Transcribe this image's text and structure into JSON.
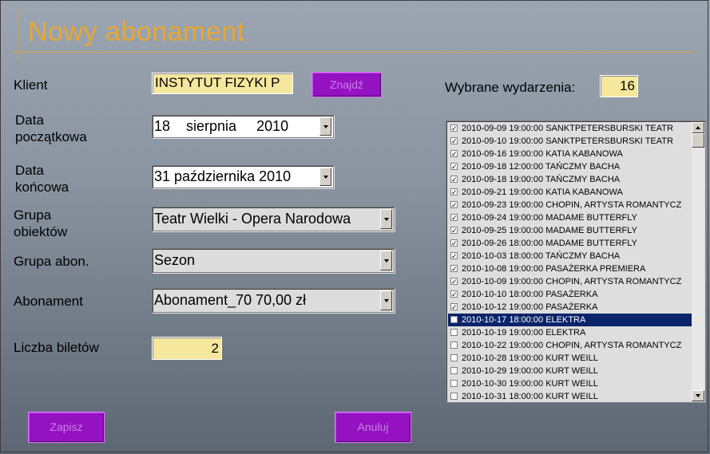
{
  "window": {
    "title": "Nowy abonament"
  },
  "form": {
    "client_label": "Klient",
    "client_value": "INSTYTUT FIZYKI P",
    "find_button": "Znajdź",
    "start_label_1": "Data",
    "start_label_2": "początkowa",
    "start_value": "18    sierpnia     2010",
    "end_label_1": "Data",
    "end_label_2": "końcowa",
    "end_value": "31 października 2010",
    "group_label_1": "Grupa",
    "group_label_2": "obiektów",
    "group_value": "Teatr Wielki - Opera Narodowa",
    "subgroup_label": "Grupa abon.",
    "subgroup_value": "Sezon",
    "subscription_label": "Abonament",
    "subscription_value": "Abonament_70 70,00 zł",
    "tickets_label": "Liczba biletów",
    "tickets_value": "2"
  },
  "events": {
    "label": "Wybrane wydarzenia:",
    "count": "16",
    "items": [
      {
        "text": "2010-09-09 19:00:00 SANKTPETERSBURSKI TEATR",
        "checked": true
      },
      {
        "text": "2010-09-10 19:00:00 SANKTPETERSBURSKI TEATR",
        "checked": true
      },
      {
        "text": "2010-09-16 19:00:00 KATIA KABANOWA",
        "checked": true
      },
      {
        "text": "2010-09-18 12:00:00 TAŃCZMY BACHA",
        "checked": true
      },
      {
        "text": "2010-09-18 19:00:00 TAŃCZMY BACHA",
        "checked": true
      },
      {
        "text": "2010-09-21 19:00:00 KATIA KABANOWA",
        "checked": true
      },
      {
        "text": "2010-09-23 19:00:00 CHOPIN, ARTYSTA ROMANTYCZ",
        "checked": true
      },
      {
        "text": "2010-09-24 19:00:00 MADAME BUTTERFLY",
        "checked": true
      },
      {
        "text": "2010-09-25 19:00:00 MADAME BUTTERFLY",
        "checked": true
      },
      {
        "text": "2010-09-26 18:00:00 MADAME BUTTERFLY",
        "checked": true
      },
      {
        "text": "2010-10-03 18:00:00 TAŃCZMY BACHA",
        "checked": true
      },
      {
        "text": "2010-10-08 19:00:00 PASAŻERKA PREMIERA",
        "checked": true
      },
      {
        "text": "2010-10-09 19:00:00 CHOPIN, ARTYSTA ROMANTYCZ",
        "checked": true
      },
      {
        "text": "2010-10-10 18:00:00 PASAŻERKA",
        "checked": true
      },
      {
        "text": "2010-10-12 19:00:00 PASAŻERKA",
        "checked": true
      },
      {
        "text": "2010-10-17 18:00:00 ELEKTRA",
        "checked": false,
        "selected": true
      },
      {
        "text": "2010-10-19 19:00:00 ELEKTRA",
        "checked": false
      },
      {
        "text": "2010-10-22 19:00:00 CHOPIN, ARTYSTA ROMANTYCZ",
        "checked": false
      },
      {
        "text": "2010-10-28 19:00:00 KURT WEILL",
        "checked": false
      },
      {
        "text": "2010-10-29 19:00:00 KURT WEILL",
        "checked": false
      },
      {
        "text": "2010-10-30 19:00:00 KURT WEILL",
        "checked": false
      },
      {
        "text": "2010-10-31 18:00:00 KURT WEILL",
        "checked": false
      }
    ]
  },
  "actions": {
    "save": "Zapisz",
    "cancel": "Anuluj"
  },
  "colors": {
    "accent": "#e8a631",
    "button": "#9412c0",
    "field": "#f5e79d",
    "selection": "#0a246a"
  }
}
